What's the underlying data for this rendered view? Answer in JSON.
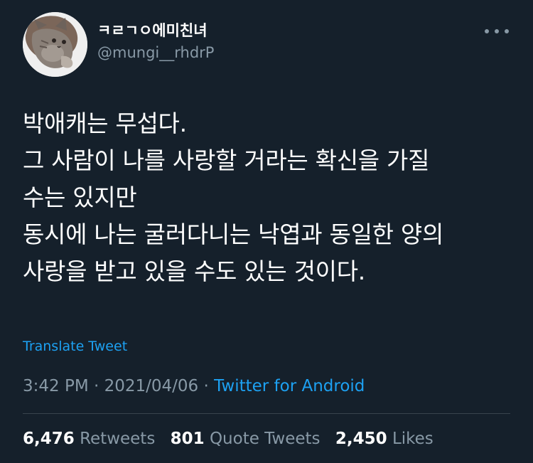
{
  "author": {
    "display_name": "ㅋㄹㄱㅇ에미친녀",
    "handle": "@mungi__rhdrP"
  },
  "tweet": {
    "lines": [
      "박애캐는 무섭다.",
      "그 사람이 나를 사랑할 거라는 확신을 가질",
      "수는 있지만",
      "동시에 나는 굴러다니는 낙엽과 동일한 양의",
      "사랑을 받고 있을 수도 있는 것이다."
    ],
    "translate_label": "Translate Tweet"
  },
  "meta": {
    "time": "3:42 PM",
    "separator1": " · ",
    "date": "2021/04/06",
    "separator2": " · ",
    "source": "Twitter for Android"
  },
  "stats": {
    "retweets_count": "6,476",
    "retweets_label": "Retweets",
    "quotes_count": "801",
    "quotes_label": "Quote Tweets",
    "likes_count": "2,450",
    "likes_label": "Likes"
  },
  "icons": {
    "more": "more-options-icon",
    "avatar": "avatar-illustration"
  },
  "colors": {
    "background": "#15202b",
    "primary_text": "#ffffff",
    "secondary_text": "#8899a6",
    "accent": "#1da1f2",
    "divider": "#38444d"
  }
}
